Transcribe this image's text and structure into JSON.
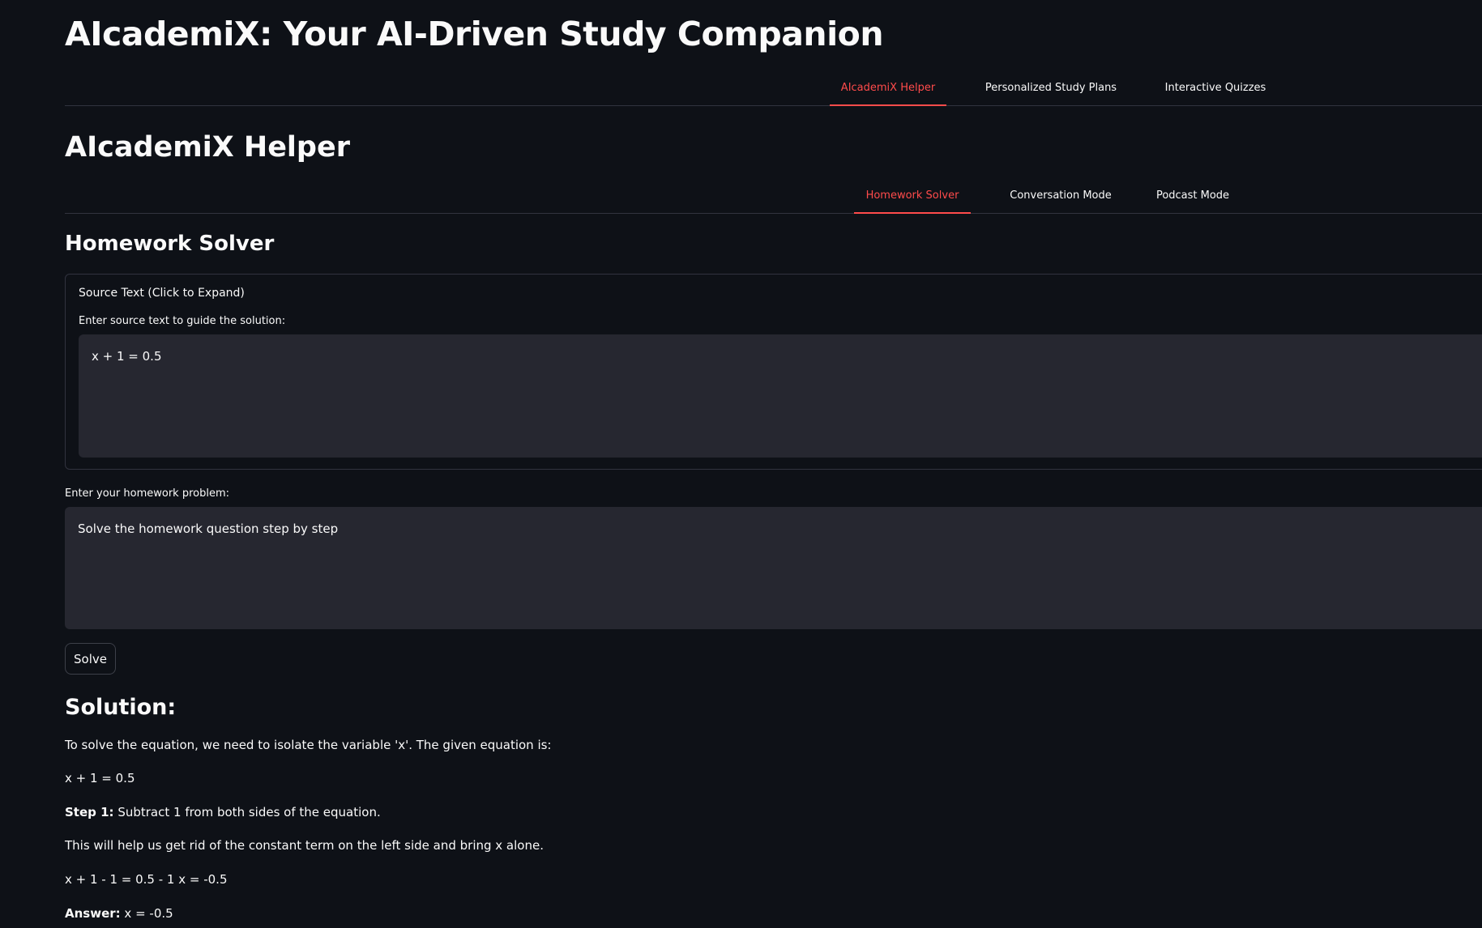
{
  "app": {
    "title": "AIcademiX: Your AI-Driven Study Companion"
  },
  "main_tabs": [
    {
      "label": "AIcademiX Helper",
      "active": true
    },
    {
      "label": "Personalized Study Plans",
      "active": false
    },
    {
      "label": "Interactive Quizzes",
      "active": false
    }
  ],
  "helper": {
    "title": "AIcademiX Helper"
  },
  "sub_tabs": [
    {
      "label": "Homework Solver",
      "active": true
    },
    {
      "label": "Conversation Mode",
      "active": false
    },
    {
      "label": "Podcast Mode",
      "active": false
    }
  ],
  "solver": {
    "title": "Homework Solver",
    "expander_label": "Source Text (Click to Expand)",
    "source_label": "Enter source text to guide the solution:",
    "source_value": "x + 1 = 0.5",
    "problem_label": "Enter your homework problem:",
    "problem_value": "Solve the homework question step by step",
    "solve_button": "Solve"
  },
  "solution": {
    "title": "Solution:",
    "intro": "To solve the equation, we need to isolate the variable 'x'. The given equation is:",
    "equation": "x + 1 = 0.5",
    "step1_label": "Step 1:",
    "step1_text": " Subtract 1 from both sides of the equation.",
    "explanation": "This will help us get rid of the constant term on the left side and bring x alone.",
    "work": "x + 1 - 1 = 0.5 - 1 x = -0.5",
    "answer_label": "Answer:",
    "answer_text": " x = -0.5"
  },
  "colors": {
    "background": "#0e1117",
    "accent": "#ff4b4b",
    "input_bg": "#262730",
    "border": "#31333f"
  }
}
